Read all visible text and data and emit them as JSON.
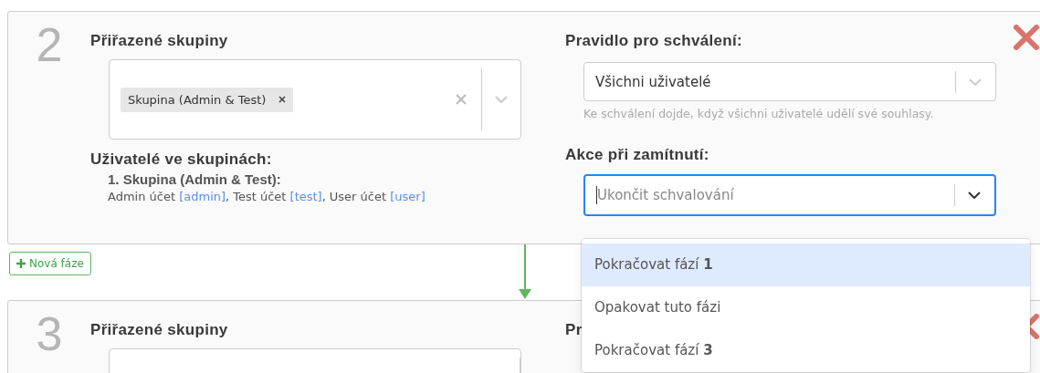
{
  "phases": [
    {
      "number": "2",
      "groups": {
        "label": "Přiřazené skupiny",
        "tags": [
          "Skupina (Admin & Test)"
        ]
      },
      "members": {
        "label": "Uživatelé ve skupinách:",
        "groups": [
          {
            "name": "1. Skupina (Admin & Test):",
            "users": [
              {
                "name": "Admin účet",
                "login": "[admin]",
                "suffix": ","
              },
              {
                "name": "Test účet",
                "login": "[test]",
                "suffix": ","
              },
              {
                "name": "User účet",
                "login": "[user]"
              }
            ]
          }
        ]
      },
      "rule": {
        "label": "Pravidlo pro schválení:",
        "value": "Všichni uživatelé",
        "hint": "Ke schválení dojde, když všichni uživatelé udělí své souhlasy."
      },
      "reject": {
        "label": "Akce při zamítnutí:",
        "placeholder": "Ukončit schvalování",
        "focused": true
      }
    },
    {
      "number": "3",
      "groups": {
        "label": "Přiřazené skupiny"
      },
      "rule": {
        "label": "Pr"
      }
    }
  ],
  "add_phase_button": "Nová fáze",
  "dropdown": {
    "options": [
      {
        "label": "Pokračovat fází **1**",
        "selected": true
      },
      {
        "label": "Opakovat tuto fázi",
        "selected": false
      },
      {
        "label": "Pokračovat fází **3**",
        "selected": false
      }
    ]
  }
}
